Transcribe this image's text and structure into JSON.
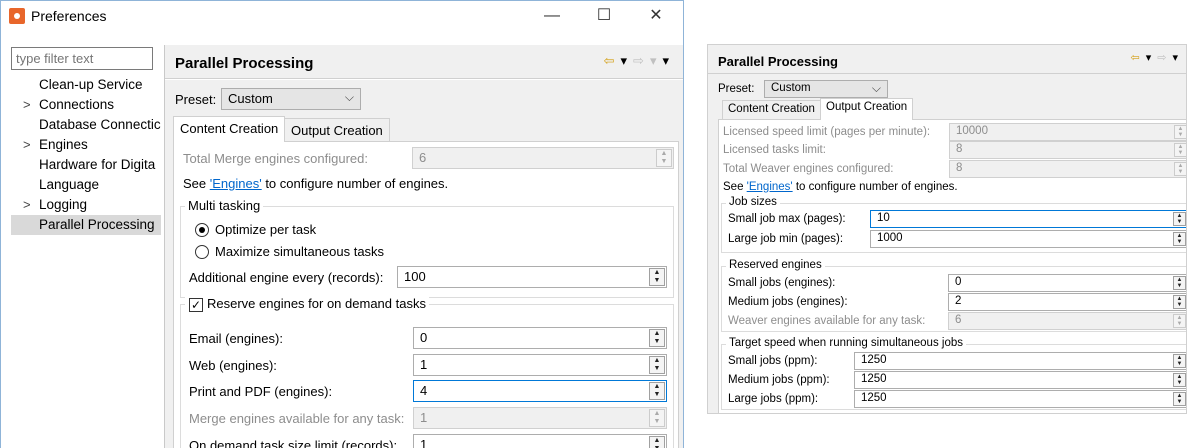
{
  "window": {
    "title": "Preferences",
    "minimize": "—",
    "maximize": "☐",
    "close": "✕"
  },
  "sidebar": {
    "filter_placeholder": "type filter text",
    "items": [
      {
        "label": "Clean-up Service",
        "expandable": false
      },
      {
        "label": "Connections",
        "expandable": true
      },
      {
        "label": "Database Connectic",
        "expandable": false
      },
      {
        "label": "Engines",
        "expandable": true
      },
      {
        "label": "Hardware for Digita",
        "expandable": false
      },
      {
        "label": "Language",
        "expandable": false
      },
      {
        "label": "Logging",
        "expandable": true
      },
      {
        "label": "Parallel Processing",
        "expandable": false,
        "selected": true
      }
    ]
  },
  "page": {
    "title": "Parallel Processing",
    "nav": {
      "back": "⇦",
      "back_menu": "▾",
      "forward": "⇨",
      "forward_menu": "▾",
      "view_menu": "▾"
    }
  },
  "content_creation": {
    "preset_label": "Preset:",
    "preset_value": "Custom",
    "tabs": [
      "Content Creation",
      "Output Creation"
    ],
    "total_merge_label": "Total Merge engines configured:",
    "total_merge_value": "6",
    "see_prefix": "See ",
    "engines_link": "'Engines'",
    "see_suffix": " to configure number of engines.",
    "multitasking": {
      "title": "Multi tasking",
      "opt1": "Optimize per task",
      "opt2": "Maximize simultaneous tasks",
      "additional_label": "Additional engine every (records):",
      "additional_value": "100"
    },
    "reserve": {
      "title": "Reserve engines for on demand tasks",
      "checked": true,
      "email_label": "Email (engines):",
      "email_value": "0",
      "web_label": "Web (engines):",
      "web_value": "1",
      "print_label": "Print and PDF (engines):",
      "print_value": "4",
      "merge_avail_label": "Merge engines available for any task:",
      "merge_avail_value": "1",
      "size_limit_label": "On demand task size limit (records):",
      "size_limit_value": "1"
    }
  },
  "output_creation": {
    "title": "Parallel Processing",
    "preset_label": "Preset:",
    "preset_value": "Custom",
    "tabs": [
      "Content Creation",
      "Output Creation"
    ],
    "speed_limit_label": "Licensed speed limit (pages per minute):",
    "speed_limit_value": "10000",
    "tasks_limit_label": "Licensed tasks limit:",
    "tasks_limit_value": "8",
    "total_weaver_label": "Total Weaver engines configured:",
    "total_weaver_value": "8",
    "see_prefix": "See ",
    "engines_link": "'Engines'",
    "see_suffix": " to configure number of engines.",
    "job_sizes": {
      "title": "Job sizes",
      "small_label": "Small job max (pages):",
      "small_value": "10",
      "large_label": "Large job min (pages):",
      "large_value": "1000"
    },
    "reserved": {
      "title": "Reserved engines",
      "small_label": "Small jobs (engines):",
      "small_value": "0",
      "medium_label": "Medium jobs (engines):",
      "medium_value": "2",
      "weaver_avail_label": "Weaver engines available for any task:",
      "weaver_avail_value": "6"
    },
    "target": {
      "title": "Target speed when running simultaneous jobs",
      "small_label": "Small jobs (ppm):",
      "small_value": "1250",
      "medium_label": "Medium jobs (ppm):",
      "medium_value": "1250",
      "large_label": "Large jobs (ppm):",
      "large_value": "1250"
    }
  }
}
